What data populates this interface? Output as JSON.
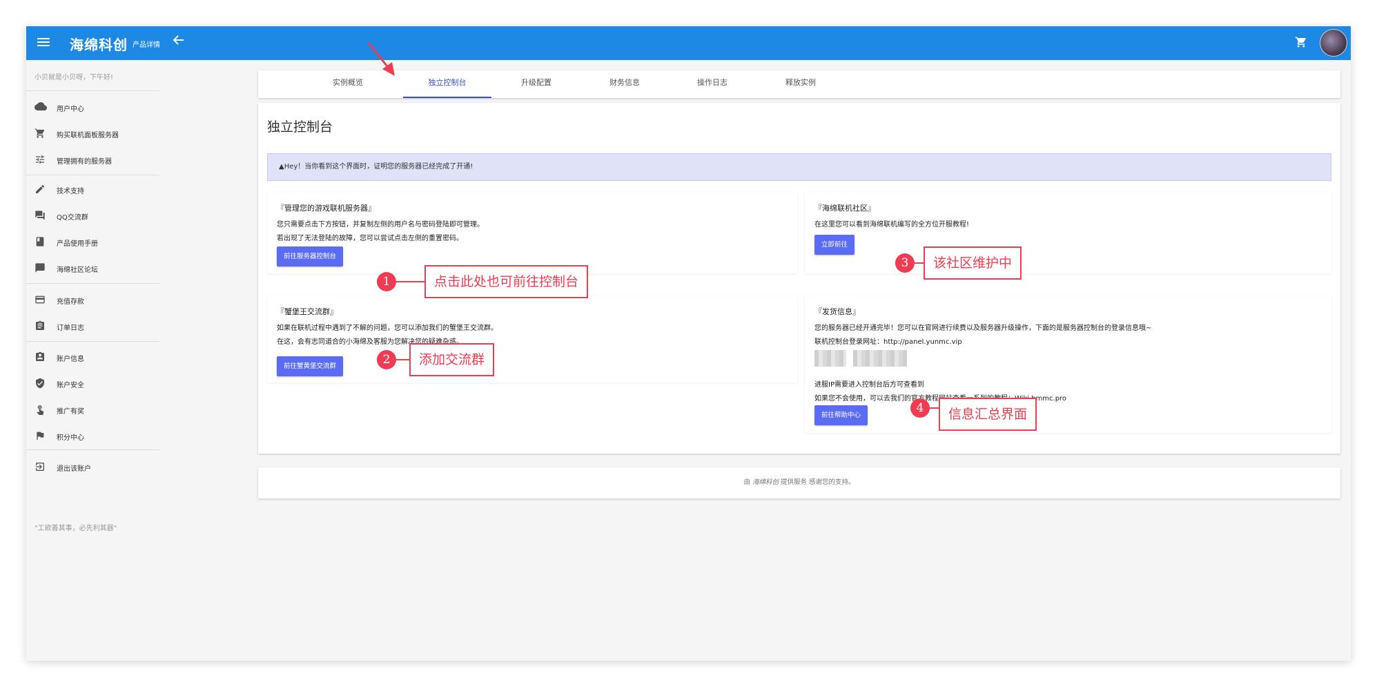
{
  "topbar": {
    "app_title": "海绵科创",
    "page_subtitle": "产品详情",
    "bg_color": "#1e88e5"
  },
  "sidebar": {
    "greeting": "小贝就是小贝呀，下午好!",
    "items": [
      {
        "label": "用户中心",
        "icon": "cloud-icon"
      },
      {
        "label": "购买联机面板服务器",
        "icon": "cart-icon"
      },
      {
        "label": "管理拥有的服务器",
        "icon": "sliders-icon"
      },
      {
        "label": "技术支持",
        "icon": "pencil-icon"
      },
      {
        "label": "QQ交流群",
        "icon": "chat-icon"
      },
      {
        "label": "产品使用手册",
        "icon": "book-icon"
      },
      {
        "label": "海绵社区论坛",
        "icon": "forum-icon"
      },
      {
        "label": "充值存款",
        "icon": "credit-card-icon"
      },
      {
        "label": "订单日志",
        "icon": "clipboard-icon"
      },
      {
        "label": "账户信息",
        "icon": "account-badge-icon"
      },
      {
        "label": "账户安全",
        "icon": "shield-check-icon"
      },
      {
        "label": "推广有奖",
        "icon": "touch-icon"
      },
      {
        "label": "积分中心",
        "icon": "flag-icon"
      },
      {
        "label": "退出该账户",
        "icon": "exit-icon"
      }
    ],
    "motto": "\"工欲善其事，必先利其器\""
  },
  "tabs": [
    "实例概览",
    "独立控制台",
    "升级配置",
    "财务信息",
    "操作日志",
    "释放实例"
  ],
  "active_tab": "独立控制台",
  "main": {
    "heading": "独立控制台",
    "alert": "▲Hey！当你看到这个界面时，证明您的服务器已经完成了开通!",
    "panels": {
      "manage": {
        "title": "『管理您的游戏联机服务器』",
        "lines": [
          "您只需要点击下方按钮，并复制左侧的用户名与密码登陆即可管理。",
          "若出现了无法登陆的故障，您可以尝试点击左侧的重置密码。"
        ],
        "button": "前往服务器控制台"
      },
      "community": {
        "title": "『海绵联机社区』",
        "lines": [
          "在这里您可以看到海绵联机编写的全方位开服教程!"
        ],
        "button": "立即前往"
      },
      "group": {
        "title": "『蟹堡王交流群』",
        "lines": [
          "如果在联机过程中遇到了不解的问题，您可以添加我们的蟹堡王交流群。",
          "在这，会有志同道合的小海绵及客服为您解决您的疑难杂惑。"
        ],
        "button": "前往蟹黄堡交流群"
      },
      "delivery": {
        "title": "『发货信息』",
        "lines": [
          "您的服务器已经开通完毕！您可以在官网进行续费以及服务器升级操作，下面的是服务器控制台的登录信息哦~",
          "联机控制台登录网址：http://panel.yunmc.vip",
          "进服IP需要进入控制台后方可查看到",
          "如果您不会使用，可以去我们的官方教程网站查看一系列的教程：Wiki.hmmc.pro"
        ],
        "button": "前往帮助中心"
      }
    }
  },
  "callouts": [
    {
      "num": "1",
      "text": "点击此处也可前往控制台"
    },
    {
      "num": "2",
      "text": "添加交流群"
    },
    {
      "num": "3",
      "text": "该社区维护中"
    },
    {
      "num": "4",
      "text": "信息汇总界面"
    }
  ],
  "footer": {
    "prefix": "由",
    "brand": "海绵科创",
    "suffix": "提供服务 感谢您的支持。"
  },
  "colors": {
    "accent": "#5b6cf2",
    "tab_active": "#3f51b5",
    "callout": "#f03c52",
    "alert_bg": "#e0e3f8"
  }
}
